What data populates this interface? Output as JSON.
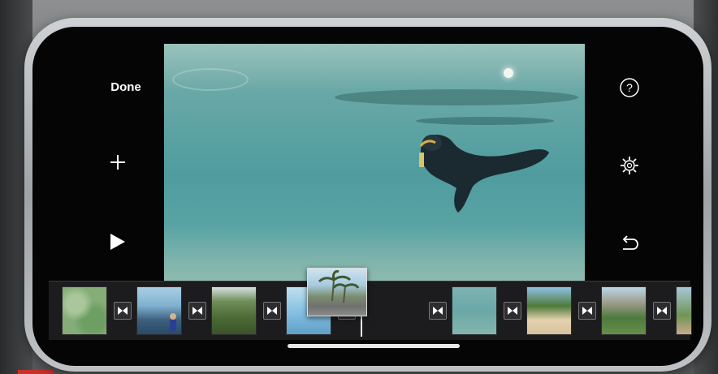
{
  "toolbar": {
    "done_label": "Done",
    "add_icon": "plus-icon",
    "play_icon": "play-icon",
    "help_icon": "question-mark-icon",
    "settings_icon": "gear-icon",
    "undo_icon": "undo-icon"
  },
  "viewer": {
    "content": "underwater-video-frame"
  },
  "timeline": {
    "clip_count": 10,
    "transition_icon": "bowtie-transition-icon"
  },
  "colors": {
    "screen_background": "#050505",
    "timeline_background": "#1c1c1e",
    "accent": "#ffffff"
  }
}
